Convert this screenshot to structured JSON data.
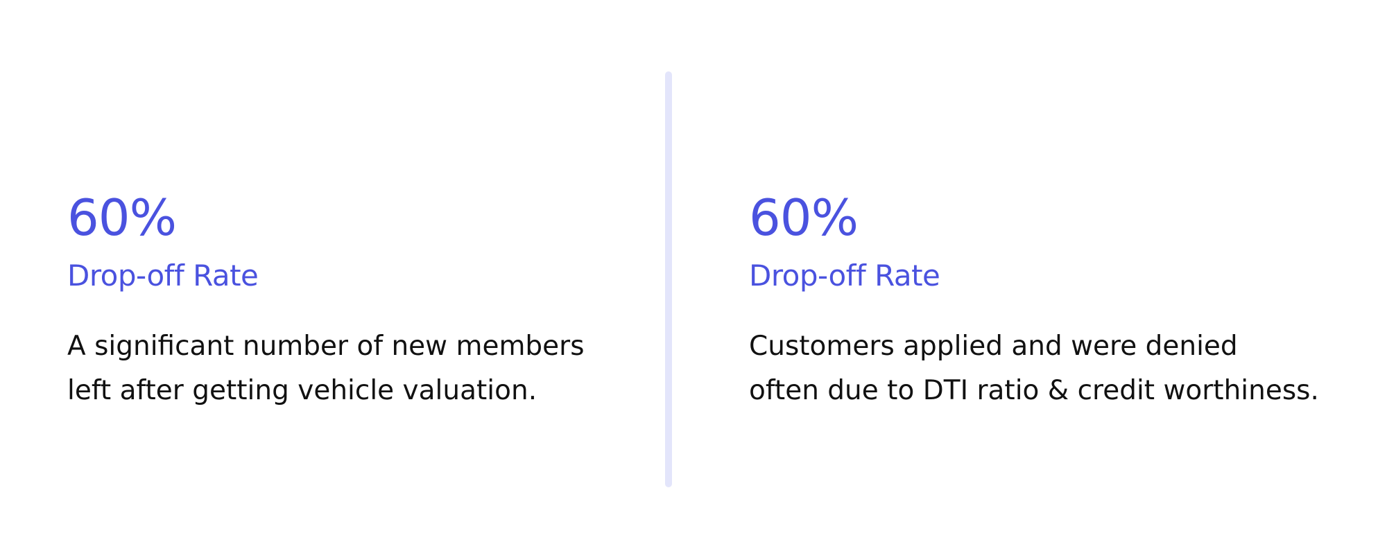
{
  "colors": {
    "accent": "#4a52df",
    "text": "#111111",
    "divider": "#e3e5fb",
    "background": "#ffffff"
  },
  "stats": [
    {
      "value": "60%",
      "label": "Drop-off Rate",
      "description_line1": "A significant number of new members",
      "description_line2": "left after getting vehicle valuation."
    },
    {
      "value": "60%",
      "label": "Drop-off Rate",
      "description_line1": "Customers applied and were denied",
      "description_line2": "often due to DTI ratio & credit worthiness."
    }
  ]
}
